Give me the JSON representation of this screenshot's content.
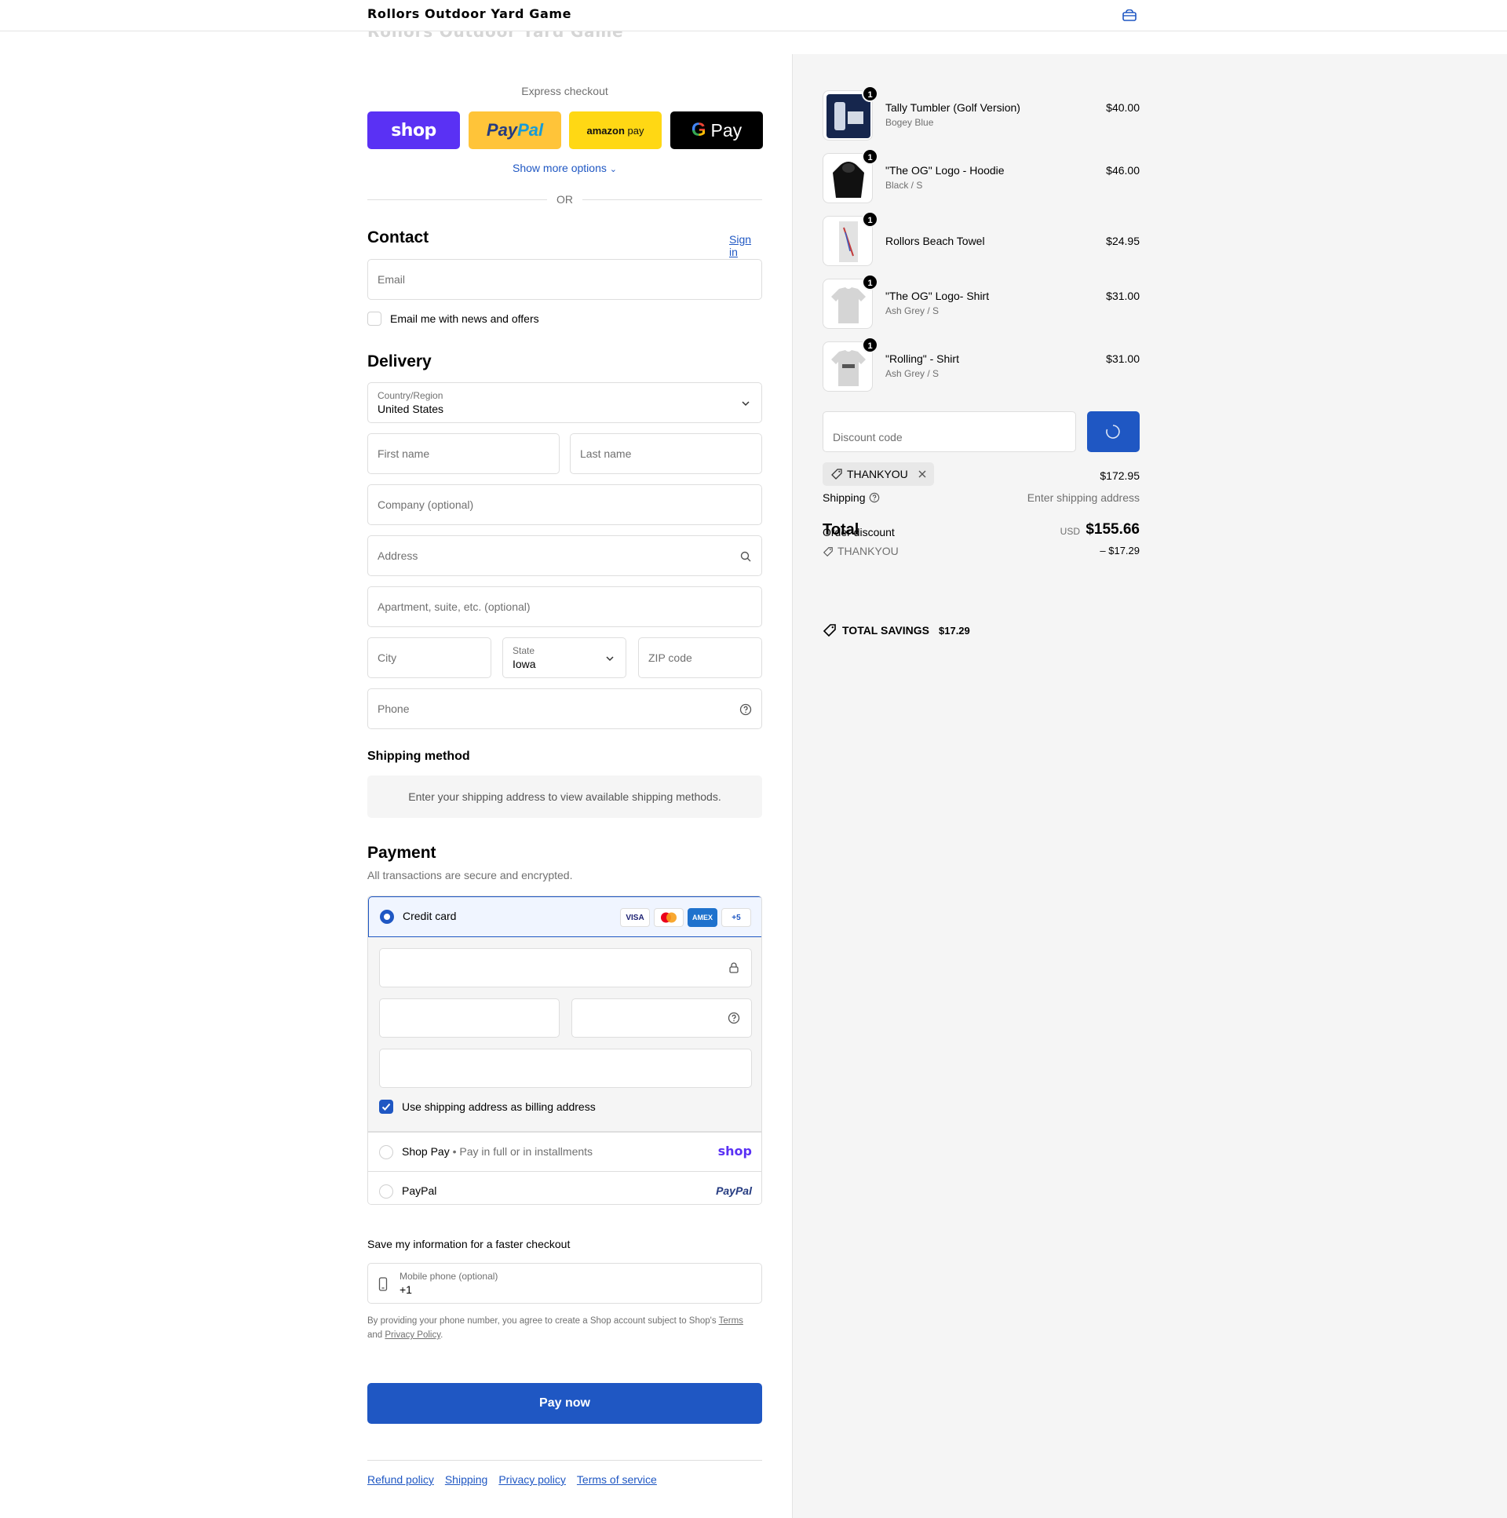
{
  "header": {
    "brand": "Rollors Outdoor Yard Game",
    "cart_icon": "bag-icon"
  },
  "express": {
    "title": "Express checkout",
    "buttons": [
      "shop",
      "PayPal",
      "amazon pay",
      "Pay"
    ],
    "more_options": "Show more options",
    "or": "OR"
  },
  "contact": {
    "title": "Contact",
    "sign_in": "Sign in",
    "email_placeholder": "Email",
    "news_label": "Email me with news and offers"
  },
  "delivery": {
    "title": "Delivery",
    "country_label": "Country/Region",
    "country_value": "United States",
    "first_name": "First name",
    "last_name": "Last name",
    "company": "Company (optional)",
    "address": "Address",
    "apartment": "Apartment, suite, etc. (optional)",
    "city": "City",
    "state_label": "State",
    "state_value": "Iowa",
    "zip": "ZIP code",
    "phone": "Phone"
  },
  "shipping_method": {
    "title": "Shipping method",
    "info": "Enter your shipping address to view available shipping methods."
  },
  "payment": {
    "title": "Payment",
    "subtitle": "All transactions are secure and encrypted.",
    "credit_card": "Credit card",
    "card_badges": [
      "VISA",
      "",
      "AMEX",
      "+5"
    ],
    "billing_same": "Use shipping address as billing address",
    "shop_pay": "Shop Pay",
    "shop_pay_desc": "Pay in full or in installments",
    "shop_pay_logo": "shop",
    "paypal": "PayPal",
    "paypal_logo": "PayPal"
  },
  "save_info": {
    "title": "Save my information for a faster checkout",
    "mobile_label": "Mobile phone (optional)",
    "mobile_value": "+1",
    "legal_1": "By providing your phone number, you agree to create a Shop account subject to Shop's ",
    "legal_terms": "Terms",
    "legal_2": "and ",
    "legal_privacy": "Privacy Policy",
    "legal_3": "."
  },
  "pay_now": "Pay now",
  "footer": {
    "links": [
      "Refund policy",
      "Shipping",
      "Privacy policy",
      "Terms of service"
    ]
  },
  "cart": {
    "items": [
      {
        "name": "Tally Tumbler (Golf Version)",
        "variant": "Bogey Blue",
        "price": "$40.00",
        "qty": "1"
      },
      {
        "name": "\"The OG\" Logo - Hoodie",
        "variant": "Black / S",
        "price": "$46.00",
        "qty": "1"
      },
      {
        "name": "Rollors Beach Towel",
        "variant": "",
        "price": "$24.95",
        "qty": "1"
      },
      {
        "name": "\"The OG\" Logo- Shirt",
        "variant": "Ash Grey / S",
        "price": "$31.00",
        "qty": "1"
      },
      {
        "name": "\"Rolling\" - Shirt",
        "variant": "Ash Grey / S",
        "price": "$31.00",
        "qty": "1"
      }
    ],
    "discount_placeholder": "Discount code",
    "applied_code": "THANKYOU",
    "subtotal": "$172.95",
    "shipping_label": "Shipping",
    "shipping_value": "Enter shipping address",
    "order_discount_label": "Order discount",
    "total_label": "Total",
    "currency": "USD",
    "total_value": "$155.66",
    "discount_code": "THANKYOU",
    "discount_amount": "– $17.29",
    "savings_label": "TOTAL SAVINGS",
    "savings_value": "$17.29"
  }
}
